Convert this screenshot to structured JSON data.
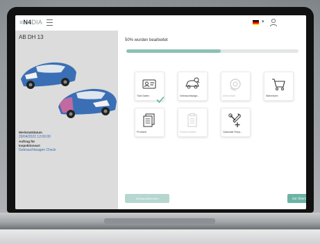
{
  "app": {
    "logo_bold": "N4",
    "logo_rest": "DIA",
    "logo_prefix": "≡"
  },
  "header": {
    "language_flag_colors": [
      "#000000",
      "#dd0000",
      "#ffce00"
    ],
    "language_caret": "▾"
  },
  "sidebar": {
    "plate": "AB DH 13",
    "fields": [
      {
        "label": "Werkstattdatum",
        "value": "29/04/2022 12:00:00"
      },
      {
        "label": "Auftrag für",
        "value": ""
      },
      {
        "label": "Inspektionsart",
        "value": "Gebrauchtwagen Check"
      }
    ]
  },
  "main": {
    "progress_text": "50% wurden bearbeitet",
    "progress_value": 0.55,
    "tiles": [
      {
        "label": "Tickt Daten",
        "icon": "id-card-icon",
        "done": true,
        "disabled": false
      },
      {
        "label": "Gebrauchtwage...",
        "icon": "car-inspection-icon",
        "done": false,
        "disabled": false
      },
      {
        "label": "Aktionsliste",
        "icon": "wheel-icon",
        "done": false,
        "disabled": true
      },
      {
        "label": "Warenkorb",
        "icon": "shopping-cart-icon",
        "done": false,
        "disabled": false
      },
      {
        "label": "Protokoll",
        "icon": "document-stack-icon",
        "done": false,
        "disabled": false
      },
      {
        "label": "Positionsdaten",
        "icon": "clipboard-icon",
        "done": false,
        "disabled": true
      },
      {
        "label": "Optionale Repa...",
        "icon": "tools-plus-icon",
        "done": false,
        "disabled": false
      }
    ],
    "btn_secondary": "Auftrag abbrechen",
    "btn_primary": "Zur Übersicht"
  },
  "colors": {
    "accent": "#6cb3a6",
    "progress": "#8ec0b5",
    "check": "#5cb88e",
    "link": "#3a6db0"
  }
}
